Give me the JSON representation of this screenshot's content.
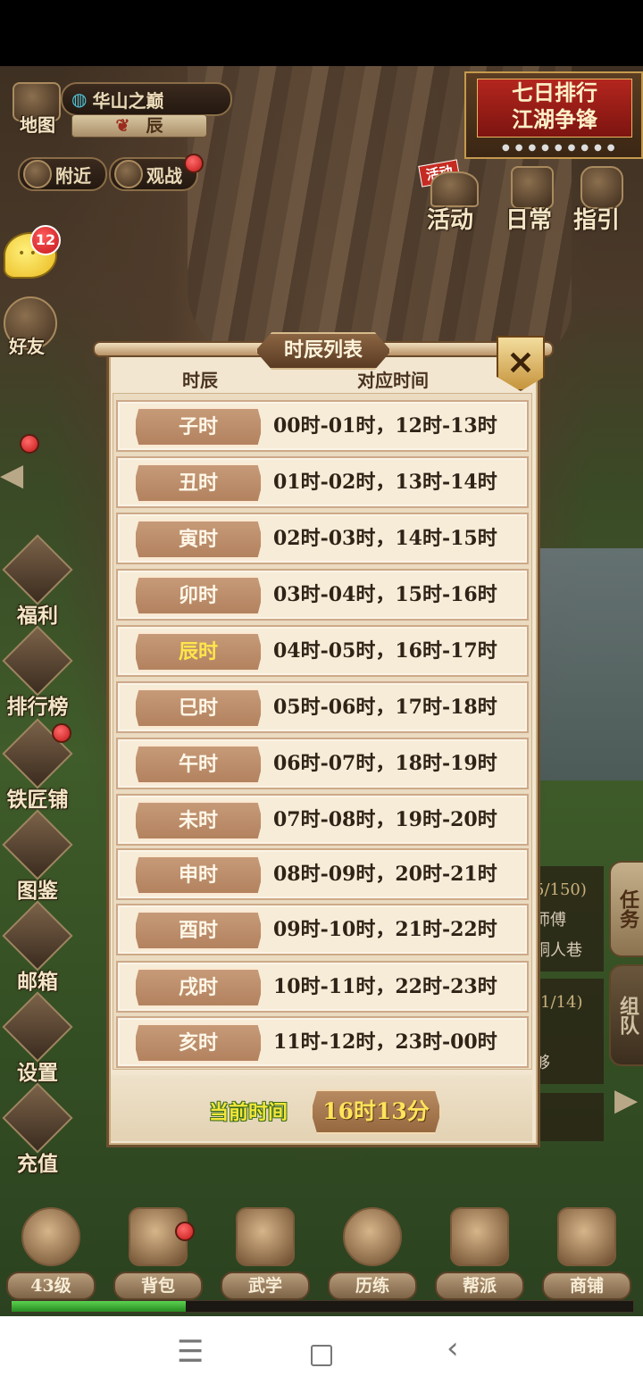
{
  "hud": {
    "map_label": "地图",
    "location_name": "华山之巅",
    "current_shichen": "辰",
    "nearby_label": "附近",
    "spectate_label": "观战",
    "event_banner_line1": "七日排行",
    "event_banner_line2": "江湖争锋",
    "activity_label": "活动",
    "activity_tag": "活动",
    "daily_label": "日常",
    "guide_label": "指引",
    "chat_badge": "12",
    "friends_label": "好友"
  },
  "sidebar": {
    "items": [
      {
        "label": "福利"
      },
      {
        "label": "排行榜"
      },
      {
        "label": "铁匠铺"
      },
      {
        "label": "图鉴"
      },
      {
        "label": "邮箱"
      },
      {
        "label": "设置"
      },
      {
        "label": "充值"
      }
    ]
  },
  "right_panel": {
    "task_tab": "任务",
    "team_tab": "组队",
    "task1_progress": "5/150)",
    "task1_line1": "师傅",
    "task1_line2": "铜人巷",
    "task2_progress": "(1/14)",
    "task2_line": "够"
  },
  "modal": {
    "title": "时辰列表",
    "col_shichen": "时辰",
    "col_time": "对应时间",
    "rows": [
      {
        "name": "子时",
        "time": "00时-01时，12时-13时"
      },
      {
        "name": "丑时",
        "time": "01时-02时，13时-14时"
      },
      {
        "name": "寅时",
        "time": "02时-03时，14时-15时"
      },
      {
        "name": "卯时",
        "time": "03时-04时，15时-16时"
      },
      {
        "name": "辰时",
        "time": "04时-05时，16时-17时"
      },
      {
        "name": "巳时",
        "time": "05时-06时，17时-18时"
      },
      {
        "name": "午时",
        "time": "06时-07时，18时-19时"
      },
      {
        "name": "未时",
        "time": "07时-08时，19时-20时"
      },
      {
        "name": "申时",
        "time": "08时-09时，20时-21时"
      },
      {
        "name": "酉时",
        "time": "09时-10时，21时-22时"
      },
      {
        "name": "戌时",
        "time": "10时-11时，22时-23时"
      },
      {
        "name": "亥时",
        "time": "11时-12时，23时-00时"
      }
    ],
    "highlighted_row": "辰时",
    "current_time_label": "当前时间",
    "current_time_value": "16时13分"
  },
  "bottom_bar": {
    "items": [
      {
        "label": "43级"
      },
      {
        "label": "背包"
      },
      {
        "label": "武学"
      },
      {
        "label": "历练"
      },
      {
        "label": "帮派"
      },
      {
        "label": "商铺"
      }
    ],
    "xp_fraction": 0.28
  },
  "colors": {
    "highlight_text": "#ffe64a",
    "current_time_label": "#f2e63a",
    "notification_red": "#d42020"
  },
  "icons": {
    "close": "close-icon",
    "chat": "chat-bubble-icon",
    "nav_menu": "menu-icon",
    "nav_home": "square-home-icon",
    "nav_back": "back-chevron-icon"
  }
}
